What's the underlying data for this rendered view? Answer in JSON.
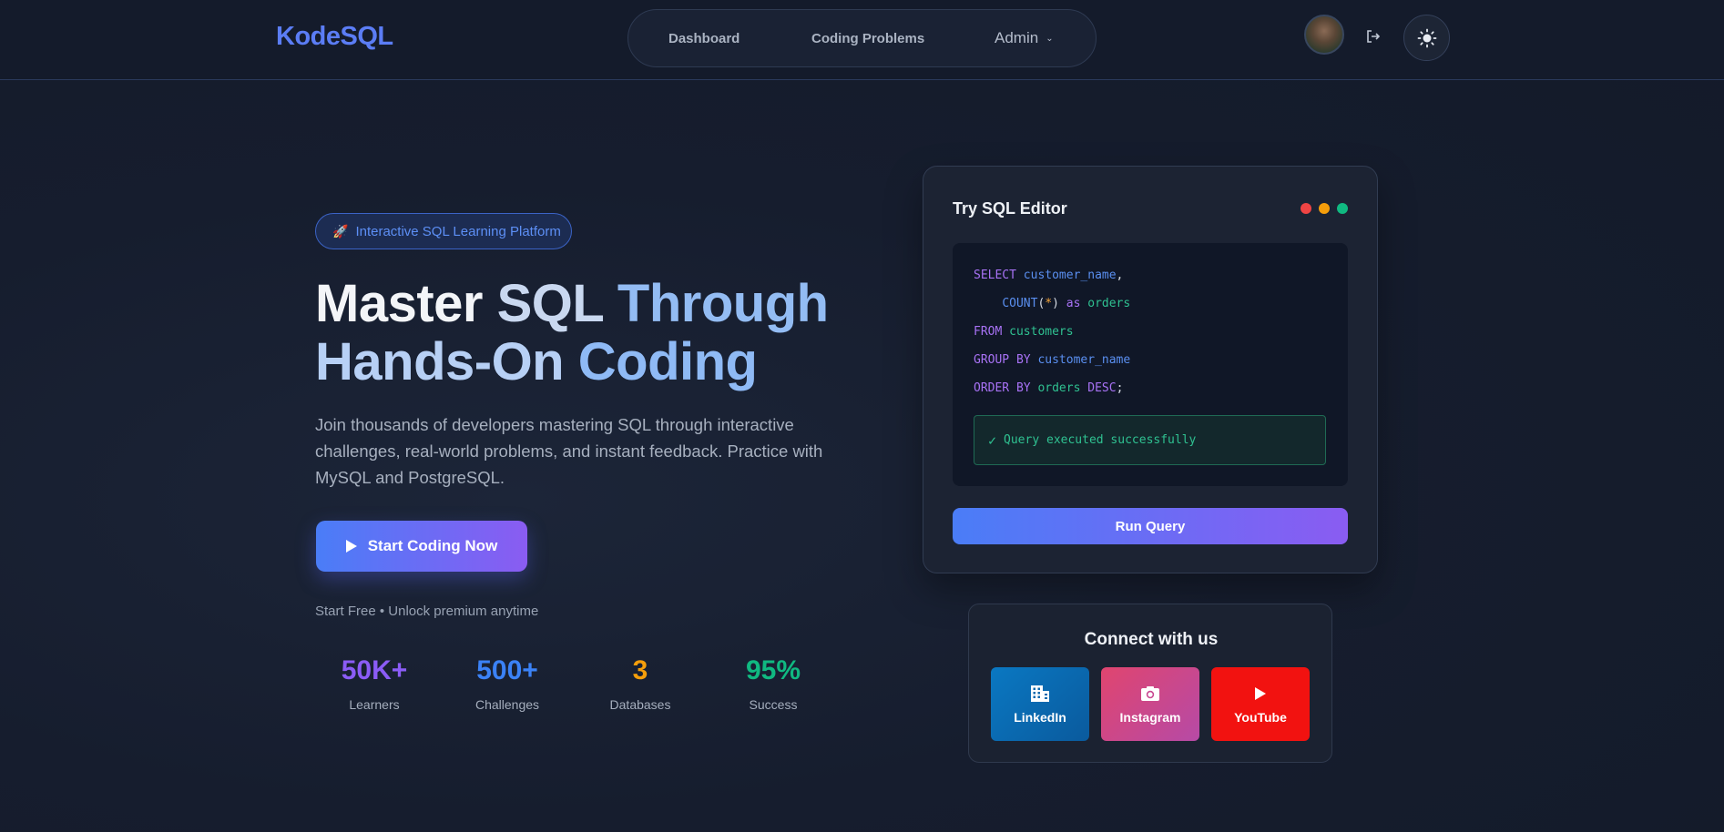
{
  "brand": {
    "logo": "KodeSQL"
  },
  "nav": {
    "dashboard": "Dashboard",
    "problems": "Coding Problems",
    "admin": "Admin"
  },
  "hero": {
    "badge": "Interactive SQL Learning Platform",
    "title_master": "Master",
    "title_sql": "SQL",
    "title_through": "Through",
    "title_hands": "Hands-On",
    "title_coding": "Coding",
    "description": "Join thousands of developers mastering SQL through interactive challenges, real-world problems, and instant feedback. Practice with MySQL and PostgreSQL.",
    "cta": "Start Coding Now",
    "note": "Start Free • Unlock premium anytime"
  },
  "stats": [
    {
      "value": "50K+",
      "label": "Learners",
      "color": "#8b5cf6"
    },
    {
      "value": "500+",
      "label": "Challenges",
      "color": "#3b82f6"
    },
    {
      "value": "3",
      "label": "Databases",
      "color": "#f59e0b"
    },
    {
      "value": "95%",
      "label": "Success",
      "color": "#10b981"
    }
  ],
  "editor": {
    "title": "Try SQL Editor",
    "dots": [
      "#ef4444",
      "#f59e0b",
      "#10b981"
    ],
    "code": {
      "l1_kw": "SELECT",
      "l1_id": "customer_name",
      "l1_p": ",",
      "l2_fn": "COUNT",
      "l2_o": "(",
      "l2_star": "*",
      "l2_c": ")",
      "l2_as": "as",
      "l2_id": "orders",
      "l3_kw": "FROM",
      "l3_id": "customers",
      "l4_kw": "GROUP BY",
      "l4_id": "customer_name",
      "l5_kw": "ORDER BY",
      "l5_id": "orders",
      "l5_desc": "DESC",
      "l5_p": ";"
    },
    "status_check": "✓",
    "status": "Query executed successfully",
    "run": "Run Query"
  },
  "social": {
    "title": "Connect with us",
    "linkedin": "LinkedIn",
    "instagram": "Instagram",
    "youtube": "YouTube"
  },
  "icons": {
    "logout": "logout-icon",
    "theme": "sun-icon",
    "badge": "rocket-icon",
    "cta": "play-icon"
  }
}
